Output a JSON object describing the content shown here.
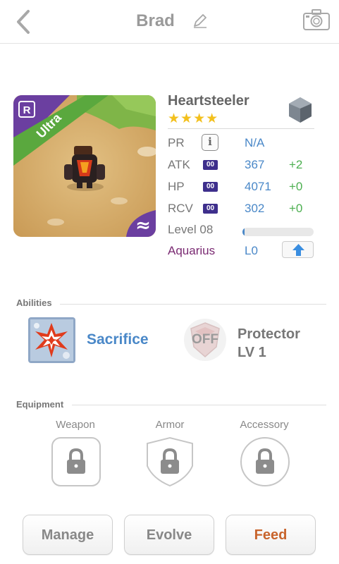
{
  "header": {
    "title": "Brad"
  },
  "unit": {
    "name": "Heartsteeler",
    "stars": "★★★★",
    "rarity_ribbon": "Ultra",
    "badge_letter": "R",
    "element_symbol": "≈"
  },
  "stats": {
    "pr": {
      "label": "PR",
      "value": "N/A"
    },
    "atk": {
      "label": "ATK",
      "badge": "00",
      "value": "367",
      "bonus": "+2"
    },
    "hp": {
      "label": "HP",
      "badge": "00",
      "value": "4071",
      "bonus": "+0"
    },
    "rcv": {
      "label": "RCV",
      "badge": "00",
      "value": "302",
      "bonus": "+0"
    },
    "level": {
      "label": "Level 08",
      "progress": 0.03
    },
    "sign": {
      "label": "Aquarius",
      "value": "L0"
    }
  },
  "abilities": {
    "section_label": "Abilities",
    "active": {
      "name": "Sacrifice"
    },
    "passive": {
      "status": "OFF",
      "name_line1": "Protector",
      "name_line2": "LV 1"
    }
  },
  "equipment": {
    "section_label": "Equipment",
    "slots": [
      {
        "label": "Weapon"
      },
      {
        "label": "Armor"
      },
      {
        "label": "Accessory"
      }
    ]
  },
  "buttons": {
    "manage": "Manage",
    "evolve": "Evolve",
    "feed": "Feed"
  },
  "colors": {
    "accent_blue": "#4a88c8",
    "bonus_green": "#4caf50",
    "star_gold": "#f3c01d",
    "ribbon_green": "#5aa83e",
    "rarity_purple": "#6b3fa0",
    "feed_orange": "#c8642c"
  }
}
